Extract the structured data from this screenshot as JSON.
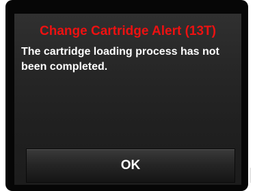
{
  "alert": {
    "title": "Change Cartridge Alert (13T)",
    "message": "The cartridge loading process has not been completed.",
    "ok_label": "OK"
  },
  "colors": {
    "title": "#ee1111",
    "text": "#ffffff",
    "background": "#262626"
  }
}
